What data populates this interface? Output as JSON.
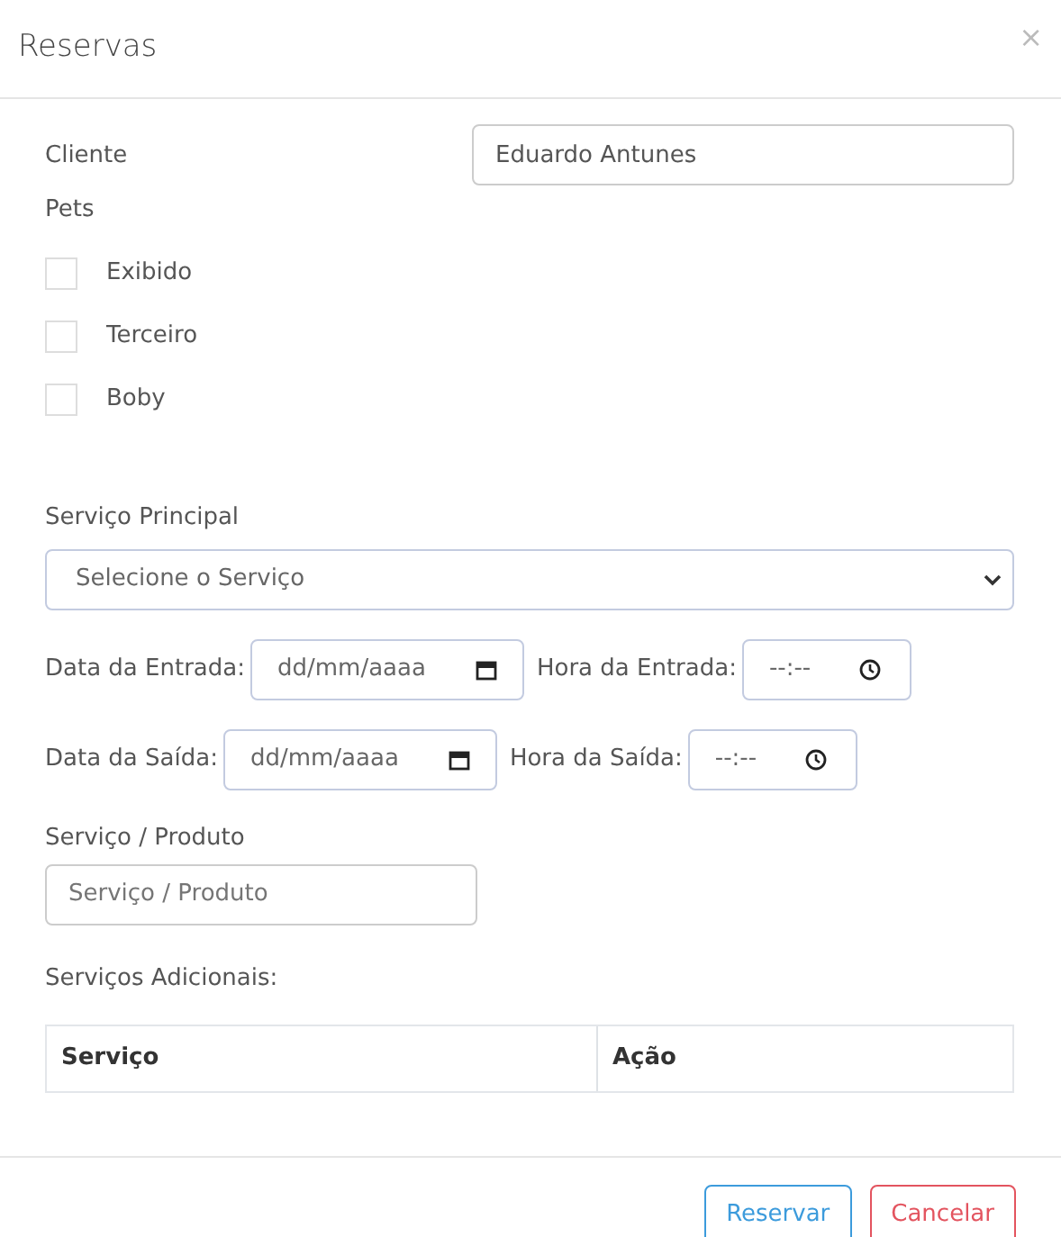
{
  "modal": {
    "title": "Reservas",
    "close": "×"
  },
  "cliente": {
    "label": "Cliente",
    "value": "Eduardo Antunes"
  },
  "pets": {
    "label": "Pets",
    "items": [
      {
        "label": "Exibido",
        "checked": false
      },
      {
        "label": "Terceiro",
        "checked": false
      },
      {
        "label": "Boby",
        "checked": false
      }
    ]
  },
  "servico_principal": {
    "label": "Serviço Principal",
    "value": "Selecione o Serviço"
  },
  "datetime_rows": [
    {
      "date_label": "Data da Entrada:",
      "date_placeholder": "dd/mm/aaaa",
      "time_label": "Hora da Entrada:",
      "time_placeholder": "--:--"
    },
    {
      "date_label": "Data da Saída:",
      "date_placeholder": "dd/mm/aaaa",
      "time_label": "Hora da Saída:",
      "time_placeholder": "--:--"
    }
  ],
  "servico_produto": {
    "label": "Serviço / Produto",
    "placeholder": "Serviço / Produto"
  },
  "adicionais": {
    "label": "Serviços Adicionais:",
    "columns": [
      "Serviço",
      "Ação"
    ]
  },
  "buttons": [
    {
      "label": "Reservar",
      "kind": "primary"
    },
    {
      "label": "Cancelar",
      "kind": "danger"
    }
  ]
}
